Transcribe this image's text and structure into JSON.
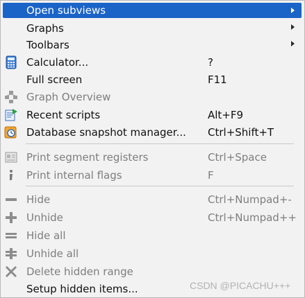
{
  "menu": {
    "items": [
      {
        "label": "Open subviews",
        "shortcut": "",
        "has_submenu": true,
        "highlighted": true,
        "enabled": true,
        "icon": "none"
      },
      {
        "label": "Graphs",
        "shortcut": "",
        "has_submenu": true,
        "enabled": true,
        "icon": "none"
      },
      {
        "label": "Toolbars",
        "shortcut": "",
        "has_submenu": true,
        "enabled": true,
        "icon": "none"
      },
      {
        "label": "Calculator...",
        "shortcut": "?",
        "has_submenu": false,
        "enabled": true,
        "icon": "calculator-icon"
      },
      {
        "label": "Full screen",
        "shortcut": "F11",
        "has_submenu": false,
        "enabled": true,
        "icon": "none"
      },
      {
        "label": "Graph Overview",
        "shortcut": "",
        "has_submenu": false,
        "enabled": false,
        "icon": "graph-overview-icon"
      },
      {
        "label": "Recent scripts",
        "shortcut": "Alt+F9",
        "has_submenu": false,
        "enabled": true,
        "icon": "recent-scripts-icon"
      },
      {
        "label": "Database snapshot manager...",
        "shortcut": "Ctrl+Shift+T",
        "has_submenu": false,
        "enabled": true,
        "icon": "snapshot-manager-icon"
      },
      {
        "label": "Print segment registers",
        "shortcut": "Ctrl+Space",
        "has_submenu": false,
        "enabled": false,
        "icon": "segment-registers-icon"
      },
      {
        "label": "Print internal flags",
        "shortcut": "F",
        "has_submenu": false,
        "enabled": false,
        "icon": "info-icon"
      },
      {
        "label": "Hide",
        "shortcut": "Ctrl+Numpad+-",
        "has_submenu": false,
        "enabled": false,
        "icon": "minus-icon"
      },
      {
        "label": "Unhide",
        "shortcut": "Ctrl+Numpad++",
        "has_submenu": false,
        "enabled": false,
        "icon": "plus-icon"
      },
      {
        "label": "Hide all",
        "shortcut": "",
        "has_submenu": false,
        "enabled": false,
        "icon": "hide-all-icon"
      },
      {
        "label": "Unhide all",
        "shortcut": "",
        "has_submenu": false,
        "enabled": false,
        "icon": "unhide-all-icon"
      },
      {
        "label": "Delete hidden range",
        "shortcut": "",
        "has_submenu": false,
        "enabled": false,
        "icon": "delete-x-icon"
      },
      {
        "label": "Setup hidden items...",
        "shortcut": "",
        "has_submenu": false,
        "enabled": true,
        "icon": "none"
      }
    ]
  },
  "watermark": "CSDN @PICACHU+++",
  "colors": {
    "highlight": "#1a64c8",
    "background": "#f2f2f2",
    "disabled_text": "#7e7e7e",
    "separator": "#c8c8c8"
  }
}
